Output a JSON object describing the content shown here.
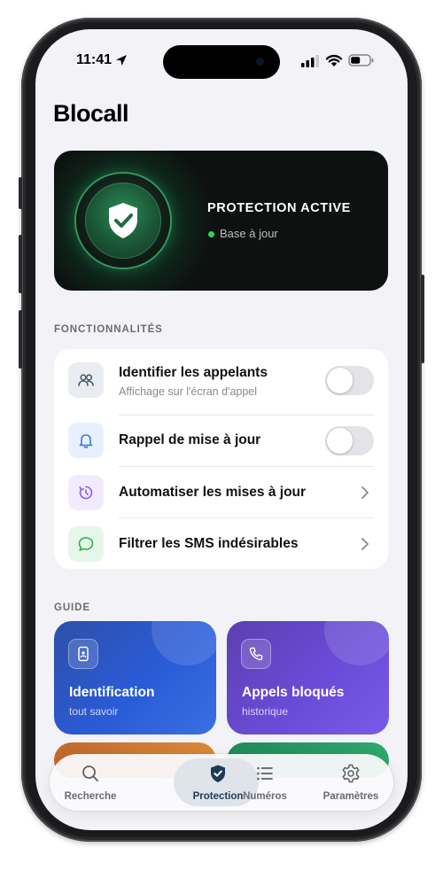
{
  "status_bar": {
    "time": "11:41"
  },
  "app": {
    "title": "Blocall"
  },
  "hero": {
    "status_title": "PROTECTION ACTIVE",
    "status_sub": "Base à jour",
    "accent": "#2fd35e"
  },
  "features": {
    "section_label": "FONCTIONNALITÉS",
    "items": [
      {
        "title": "Identifier les appelants",
        "subtitle": "Affichage sur l'écran d'appel",
        "control": "toggle",
        "on": false,
        "icon": "people-icon"
      },
      {
        "title": "Rappel de mise à jour",
        "subtitle": "",
        "control": "toggle",
        "on": false,
        "icon": "bell-icon"
      },
      {
        "title": "Automatiser les mises à jour",
        "subtitle": "",
        "control": "chevron",
        "icon": "timer-icon"
      },
      {
        "title": "Filtrer les SMS indésirables",
        "subtitle": "",
        "control": "chevron",
        "icon": "message-icon"
      }
    ]
  },
  "guide": {
    "section_label": "GUIDE",
    "cards": [
      {
        "title": "Identification",
        "subtitle": "tout savoir",
        "icon": "phone-id-icon",
        "color": "#2a5bd7"
      },
      {
        "title": "Appels bloqués",
        "subtitle": "historique",
        "icon": "phone-icon",
        "color": "#6a4bd8"
      }
    ]
  },
  "tabbar": {
    "tabs": [
      {
        "label": "Recherche",
        "icon": "search-icon",
        "active": false
      },
      {
        "label": "Protection",
        "icon": "shield-icon",
        "active": true
      },
      {
        "label": "Numéros",
        "icon": "list-icon",
        "active": false
      },
      {
        "label": "Paramètres",
        "icon": "gear-icon",
        "active": false
      }
    ]
  }
}
